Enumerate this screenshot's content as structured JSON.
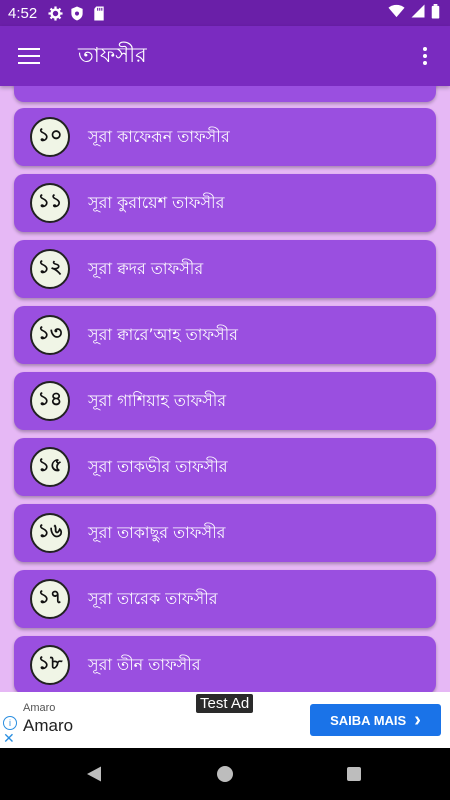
{
  "status_bar": {
    "time": "4:52",
    "icons_left": [
      "settings-icon",
      "shield-icon",
      "sd-card-icon"
    ],
    "icons_right": [
      "wifi-icon",
      "signal-icon",
      "battery-icon"
    ]
  },
  "app_bar": {
    "title": "তাফসীর",
    "menu_icon": "hamburger-menu-icon",
    "more_icon": "more-vert-icon"
  },
  "list": {
    "items": [
      {
        "number": "১০",
        "label": "সূরা কাফেরূন তাফসীর"
      },
      {
        "number": "১১",
        "label": "সূরা কুরায়েশ তাফসীর"
      },
      {
        "number": "১২",
        "label": "সূরা ক্বদর তাফসীর"
      },
      {
        "number": "১৩",
        "label": "সূরা ক্বারে’আহ তাফসীর"
      },
      {
        "number": "১৪",
        "label": "সূরা গাশিয়াহ তাফসীর"
      },
      {
        "number": "১৫",
        "label": "সূরা তাকভীর তাফসীর"
      },
      {
        "number": "১৬",
        "label": "সূরা তাকাছুর তাফসীর"
      },
      {
        "number": "১৭",
        "label": "সূরা তারেক তাফসীর"
      },
      {
        "number": "১৮",
        "label": "সূরা তীন তাফসীর"
      }
    ]
  },
  "ad": {
    "badge": "Test Ad",
    "advertiser_small": "Amaro",
    "advertiser_name": "Amaro",
    "cta": "SAIBA MAIS",
    "info_glyph": "i",
    "close_glyph": "✕",
    "cta_arrow": "›"
  },
  "colors": {
    "status_bar": "#6a1fa8",
    "app_bar": "#7a2bc0",
    "background": "#e6b8f5",
    "card": "#9a4fe0",
    "cta": "#1a73e8"
  }
}
